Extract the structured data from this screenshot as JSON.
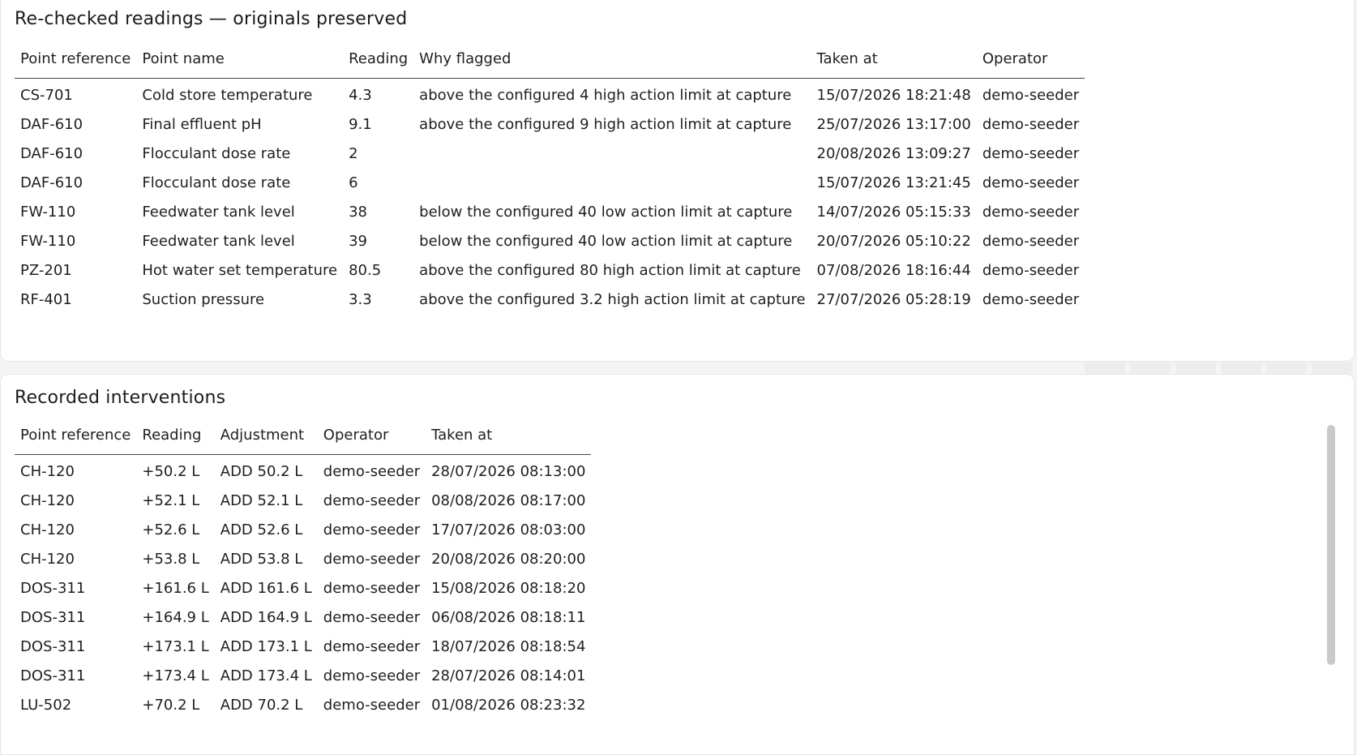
{
  "rechecked": {
    "title": "Re-checked readings — originals preserved",
    "columns": [
      "Point reference",
      "Point name",
      "Reading",
      "Why flagged",
      "Taken at",
      "Operator"
    ],
    "rows": [
      [
        "CS-701",
        "Cold store temperature",
        "4.3",
        "above the configured 4 high action limit at capture",
        "15/07/2026 18:21:48",
        "demo-seeder"
      ],
      [
        "DAF-610",
        "Final effluent pH",
        "9.1",
        "above the configured 9 high action limit at capture",
        "25/07/2026 13:17:00",
        "demo-seeder"
      ],
      [
        "DAF-610",
        "Flocculant dose rate",
        "2",
        "",
        "20/08/2026 13:09:27",
        "demo-seeder"
      ],
      [
        "DAF-610",
        "Flocculant dose rate",
        "6",
        "",
        "15/07/2026 13:21:45",
        "demo-seeder"
      ],
      [
        "FW-110",
        "Feedwater tank level",
        "38",
        "below the configured 40 low action limit at capture",
        "14/07/2026 05:15:33",
        "demo-seeder"
      ],
      [
        "FW-110",
        "Feedwater tank level",
        "39",
        "below the configured 40 low action limit at capture",
        "20/07/2026 05:10:22",
        "demo-seeder"
      ],
      [
        "PZ-201",
        "Hot water set temperature",
        "80.5",
        "above the configured 80 high action limit at capture",
        "07/08/2026 18:16:44",
        "demo-seeder"
      ],
      [
        "RF-401",
        "Suction pressure",
        "3.3",
        "above the configured 3.2 high action limit at capture",
        "27/07/2026 05:28:19",
        "demo-seeder"
      ]
    ]
  },
  "interventions": {
    "title": "Recorded interventions",
    "columns": [
      "Point reference",
      "Reading",
      "Adjustment",
      "Operator",
      "Taken at"
    ],
    "rows": [
      [
        "CH-120",
        "+50.2 L",
        "ADD 50.2 L",
        "demo-seeder",
        "28/07/2026 08:13:00"
      ],
      [
        "CH-120",
        "+52.1 L",
        "ADD 52.1 L",
        "demo-seeder",
        "08/08/2026 08:17:00"
      ],
      [
        "CH-120",
        "+52.6 L",
        "ADD 52.6 L",
        "demo-seeder",
        "17/07/2026 08:03:00"
      ],
      [
        "CH-120",
        "+53.8 L",
        "ADD 53.8 L",
        "demo-seeder",
        "20/08/2026 08:20:00"
      ],
      [
        "DOS-311",
        "+161.6 L",
        "ADD 161.6 L",
        "demo-seeder",
        "15/08/2026 08:18:20"
      ],
      [
        "DOS-311",
        "+164.9 L",
        "ADD 164.9 L",
        "demo-seeder",
        "06/08/2026 08:18:11"
      ],
      [
        "DOS-311",
        "+173.1 L",
        "ADD 173.1 L",
        "demo-seeder",
        "18/07/2026 08:18:54"
      ],
      [
        "DOS-311",
        "+173.4 L",
        "ADD 173.4 L",
        "demo-seeder",
        "28/07/2026 08:14:01"
      ],
      [
        "LU-502",
        "+70.2 L",
        "ADD 70.2 L",
        "demo-seeder",
        "01/08/2026 08:23:32"
      ]
    ]
  }
}
